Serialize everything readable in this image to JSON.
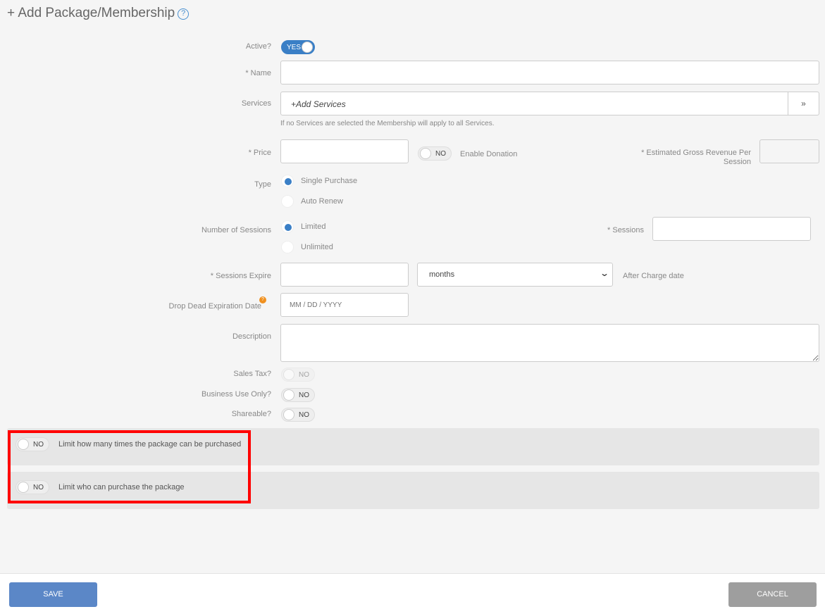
{
  "title": "+ Add Package/Membership",
  "help_icon": "?",
  "active": {
    "label": "Active?",
    "value": "YES"
  },
  "name": {
    "label": "* Name",
    "value": ""
  },
  "services": {
    "label": "Services",
    "placeholder": "+Add Services",
    "hint": "If no Services are selected the Membership will apply to all Services."
  },
  "price": {
    "label": "* Price",
    "value": "",
    "donation_toggle": "NO",
    "donation_label": "Enable Donation"
  },
  "revenue": {
    "label_line1": "* Estimated Gross Revenue Per",
    "label_line2": "Session",
    "value": ""
  },
  "type": {
    "label": "Type",
    "options": [
      "Single Purchase",
      "Auto Renew"
    ],
    "selected": "Single Purchase"
  },
  "num_sessions": {
    "label": "Number of Sessions",
    "options": [
      "Limited",
      "Unlimited"
    ],
    "selected": "Limited"
  },
  "sessions": {
    "label": "* Sessions",
    "value": ""
  },
  "expire": {
    "label": "* Sessions Expire",
    "value": "",
    "unit": "months",
    "after": "After Charge date"
  },
  "drop_dead": {
    "label": "Drop Dead Expiration Date",
    "placeholder": "MM / DD / YYYY",
    "badge": "?"
  },
  "description": {
    "label": "Description",
    "value": ""
  },
  "sales_tax": {
    "label": "Sales Tax?",
    "value": "NO"
  },
  "business_use": {
    "label": "Business Use Only?",
    "value": "NO"
  },
  "shareable": {
    "label": "Shareable?",
    "value": "NO"
  },
  "limits": [
    {
      "toggle": "NO",
      "label": "Limit how many times the package can be purchased"
    },
    {
      "toggle": "NO",
      "label": "Limit who can purchase the package"
    }
  ],
  "footer": {
    "save": "SAVE",
    "cancel": "CANCEL"
  },
  "colors": {
    "accent": "#3a7fc6",
    "save": "#5b87c7",
    "cancel": "#9e9e9e",
    "highlight": "#ff0000"
  }
}
